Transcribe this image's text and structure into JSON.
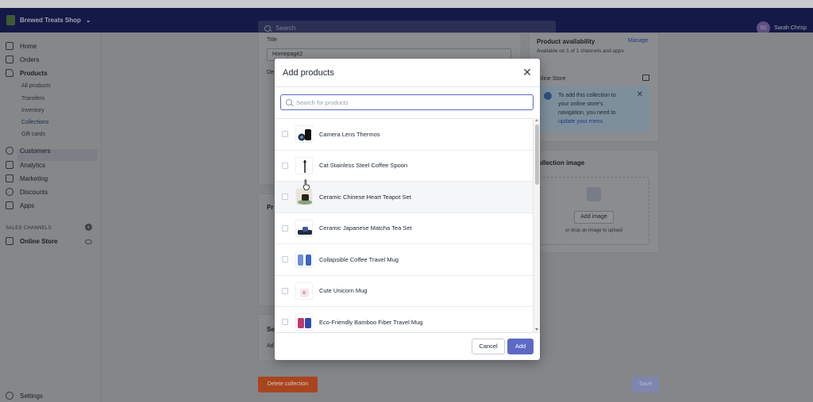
{
  "topbar": {
    "store_name": "Brewed Treats Shop",
    "search_placeholder": "Search",
    "user_initials": "SC",
    "user_name": "Sarah Chrisp"
  },
  "sidebar": {
    "items": [
      {
        "label": "Home",
        "icon": "home-icon"
      },
      {
        "label": "Orders",
        "icon": "orders-icon"
      },
      {
        "label": "Products",
        "icon": "tag-icon"
      },
      {
        "label": "Customers",
        "icon": "person-icon"
      },
      {
        "label": "Analytics",
        "icon": "chart-icon"
      },
      {
        "label": "Marketing",
        "icon": "megaphone-icon"
      },
      {
        "label": "Discounts",
        "icon": "discount-icon"
      },
      {
        "label": "Apps",
        "icon": "apps-icon"
      }
    ],
    "product_subitems": [
      "All products",
      "Transfers",
      "Inventory",
      "Collections",
      "Gift cards"
    ],
    "active_subitem": "Collections",
    "channels_title": "SALES CHANNELS",
    "online_store": "Online Store",
    "settings": "Settings"
  },
  "page": {
    "title_label": "Title",
    "title_value": "Homepage2",
    "desc_label_fragment": "De",
    "products_fragment": "Pr",
    "seo_fragment": "Se",
    "seo_sub_fragment": "Ad",
    "availability_title": "Product availability",
    "availability_manage": "Manage",
    "availability_sub": "Available on 1 of 1 channels and apps",
    "online_store_label": "nline Store",
    "info_text": "To add this collection to your online store's navigation, you need to",
    "info_link": "update your menu",
    "image_title": "ollection image",
    "add_image": "Add image",
    "drop_hint": "or drop an image to upload",
    "delete_button": "Delete collection",
    "save_button": "Save"
  },
  "modal": {
    "title": "Add products",
    "search_placeholder": "Search for products",
    "products": [
      {
        "name": "Camera Lens Thermos"
      },
      {
        "name": "Cat Stainless Steel Coffee Spoon"
      },
      {
        "name": "Ceramic Chinese Heart Teapot Set"
      },
      {
        "name": "Ceramic Japanese Matcha Tea Set"
      },
      {
        "name": "Collapsible Coffee Travel Mug"
      },
      {
        "name": "Cute Unicorn Mug"
      },
      {
        "name": "Eco-Friendly Bamboo Fiber Travel Mug"
      }
    ],
    "cancel_label": "Cancel",
    "add_label": "Add",
    "accent_color": "#5c6ac4"
  }
}
